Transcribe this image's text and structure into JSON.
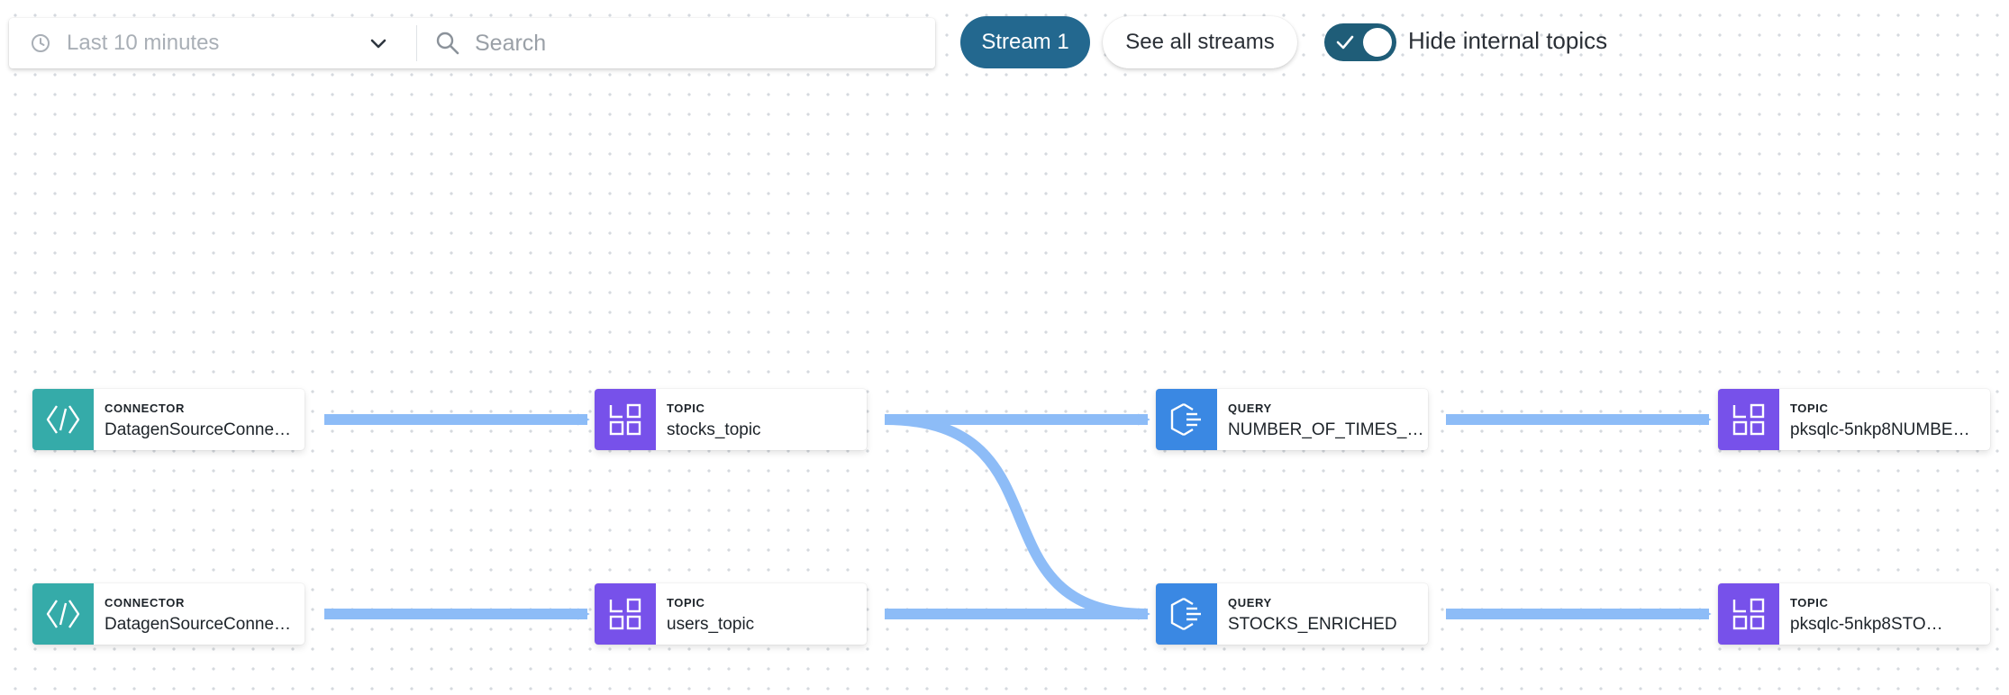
{
  "toolbar": {
    "time_range": "Last 10 minutes",
    "search_placeholder": "Search",
    "stream_button": "Stream 1",
    "see_all_button": "See all streams",
    "toggle_on": true,
    "toggle_label": "Hide internal topics"
  },
  "colors": {
    "connector": "#35aba9",
    "topic": "#7751ea",
    "query": "#3a88e3",
    "edge": "#8dbcf7",
    "accent": "#23688f"
  },
  "nodes": [
    {
      "id": "connector_1",
      "kind": "CONNECTOR",
      "name": "DatagenSourceConne…",
      "icon": "connector-icon"
    },
    {
      "id": "connector_2",
      "kind": "CONNECTOR",
      "name": "DatagenSourceConne…",
      "icon": "connector-icon"
    },
    {
      "id": "stocks_topic",
      "kind": "TOPIC",
      "name": "stocks_topic",
      "icon": "topic-icon"
    },
    {
      "id": "users_topic",
      "kind": "TOPIC",
      "name": "users_topic",
      "icon": "topic-icon"
    },
    {
      "id": "query_number_of_times",
      "kind": "QUERY",
      "name": "NUMBER_OF_TIMES_…",
      "icon": "query-icon"
    },
    {
      "id": "query_stocks_enriched",
      "kind": "QUERY",
      "name": "STOCKS_ENRICHED",
      "icon": "query-icon"
    },
    {
      "id": "topic_out_1",
      "kind": "TOPIC",
      "name": "pksqlc-5nkp8NUMBE…",
      "icon": "topic-icon"
    },
    {
      "id": "topic_out_2",
      "kind": "TOPIC",
      "name": "pksqlc-5nkp8STO…",
      "icon": "topic-icon"
    }
  ],
  "edges": [
    {
      "from": "connector_1",
      "to": "stocks_topic"
    },
    {
      "from": "connector_2",
      "to": "users_topic"
    },
    {
      "from": "stocks_topic",
      "to": "query_number_of_times"
    },
    {
      "from": "stocks_topic",
      "to": "query_stocks_enriched"
    },
    {
      "from": "users_topic",
      "to": "query_stocks_enriched"
    },
    {
      "from": "query_number_of_times",
      "to": "topic_out_1"
    },
    {
      "from": "query_stocks_enriched",
      "to": "topic_out_2"
    }
  ]
}
